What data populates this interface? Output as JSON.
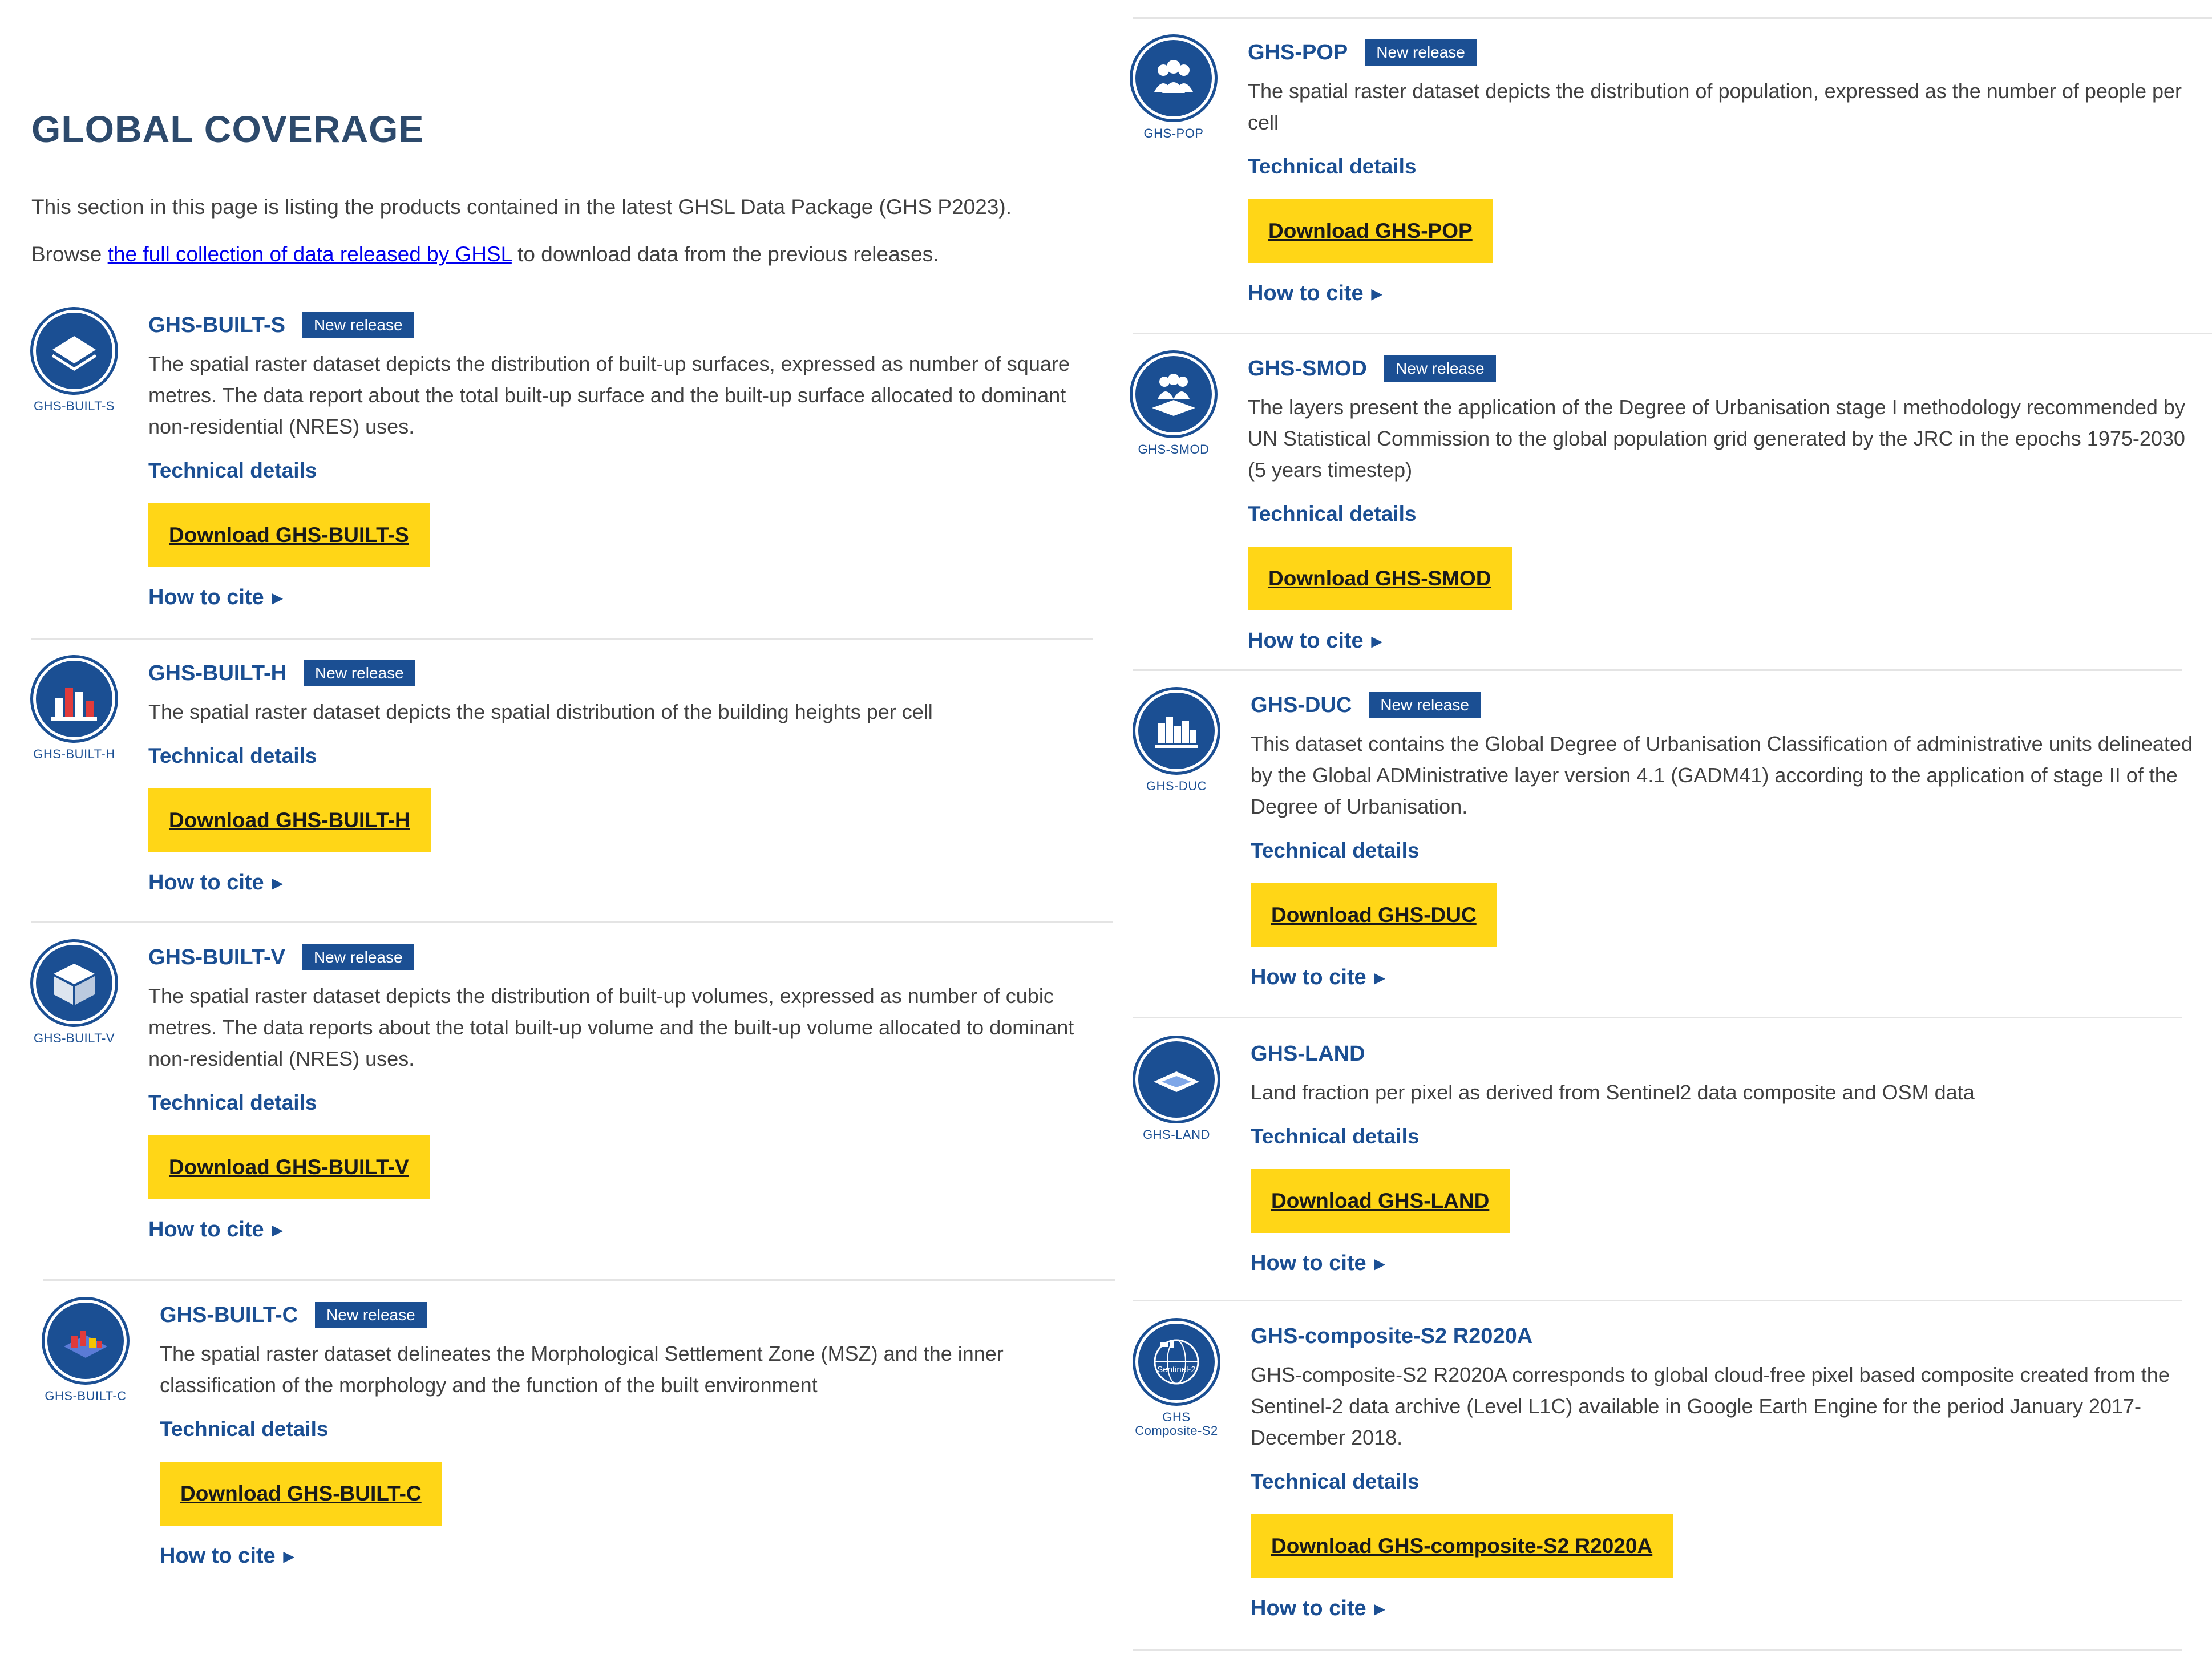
{
  "header": {
    "title": "GLOBAL COVERAGE",
    "intro_text": "This section in this page is listing the products contained in the latest GHSL Data Package (GHS P2023).",
    "browse_prefix": "Browse ",
    "browse_link": "the full collection of data released by GHSL",
    "browse_suffix": " to download data from the previous releases."
  },
  "products": [
    {
      "title": "GHS-BUILT-S",
      "badge": "New release",
      "logo_caption": "GHS-BUILT-S",
      "icon": "layer-stack-icon",
      "desc": "The spatial raster dataset depicts the distribution of built-up surfaces, expressed as number of square metres. The data report about the total built-up surface and the built-up surface allocated to dominant non-residential (NRES) uses.",
      "tech": "Technical details",
      "download": "Download GHS-BUILT-S",
      "cite": "How to cite",
      "arrow": "▶"
    },
    {
      "title": "GHS-BUILT-H",
      "badge": "New release",
      "logo_caption": "GHS-BUILT-H",
      "icon": "buildings-icon",
      "desc": "The spatial raster dataset depicts the spatial distribution of the building heights per cell",
      "tech": "Technical details",
      "download": "Download GHS-BUILT-H",
      "cite": "How to cite",
      "arrow": "▶"
    },
    {
      "title": "GHS-BUILT-V",
      "badge": "New release",
      "logo_caption": "GHS-BUILT-V",
      "icon": "cube-icon",
      "desc": "The spatial raster dataset depicts the distribution of built-up volumes, expressed as number of cubic metres. The data reports about the total built-up volume and the built-up volume allocated to dominant non-residential (NRES) uses.",
      "tech": "Technical details",
      "download": "Download GHS-BUILT-V",
      "cite": "How to cite",
      "arrow": "▶"
    },
    {
      "title": "GHS-BUILT-C",
      "badge": "New release",
      "logo_caption": "GHS-BUILT-C",
      "icon": "settlement-zone-icon",
      "desc": "The spatial raster dataset delineates the Morphological Settlement Zone (MSZ) and the inner classification of the morphology and the function of the built environment",
      "tech": "Technical details",
      "download": "Download GHS-BUILT-C",
      "cite": "How to cite",
      "arrow": "▶"
    },
    {
      "title": "GHS-POP",
      "badge": "New release",
      "logo_caption": "GHS-POP",
      "icon": "people-icon",
      "desc": "The spatial raster dataset depicts the distribution of population, expressed as the number of people per cell",
      "tech": "Technical details",
      "download": "Download GHS-POP",
      "cite": "How to cite",
      "arrow": "▶"
    },
    {
      "title": "GHS-SMOD",
      "badge": "New release",
      "logo_caption": "GHS-SMOD",
      "icon": "people-layer-icon",
      "desc": "The layers present the application of the Degree of Urbanisation stage I methodology recommended by UN Statistical Commission to the global population grid generated by the JRC in the epochs 1975-2030 (5 years timestep)",
      "tech": "Technical details",
      "download": "Download GHS-SMOD",
      "cite": "How to cite",
      "arrow": "▶"
    },
    {
      "title": "GHS-DUC",
      "badge": "New release",
      "logo_caption": "GHS-DUC",
      "icon": "city-skyline-icon",
      "desc": "This dataset contains the Global Degree of Urbanisation Classification of administrative units delineated by the Global ADMinistrative layer version 4.1 (GADM41) according to the application of stage II of the Degree of Urbanisation.",
      "tech": "Technical details",
      "download": "Download GHS-DUC",
      "cite": "How to cite",
      "arrow": "▶"
    },
    {
      "title": "GHS-LAND",
      "badge": "",
      "logo_caption": "GHS-LAND",
      "icon": "land-plate-icon",
      "desc": "Land fraction per pixel as derived from Sentinel2 data composite and OSM data",
      "tech": "Technical details",
      "download": "Download GHS-LAND",
      "cite": "How to cite",
      "arrow": "▶"
    },
    {
      "title": "GHS-composite-S2 R2020A",
      "badge": "",
      "logo_caption": "GHS Composite-S2",
      "logo_inner_text": "Sentinel-2",
      "icon": "satellite-globe-icon",
      "desc": "GHS-composite-S2 R2020A corresponds to global cloud-free pixel based composite created from the Sentinel-2 data archive (Level L1C) available in Google Earth Engine for the period January 2017-December 2018.",
      "tech": "Technical details",
      "download": "Download GHS-composite-S2 R2020A",
      "cite": "How to cite",
      "arrow": "▶"
    }
  ]
}
